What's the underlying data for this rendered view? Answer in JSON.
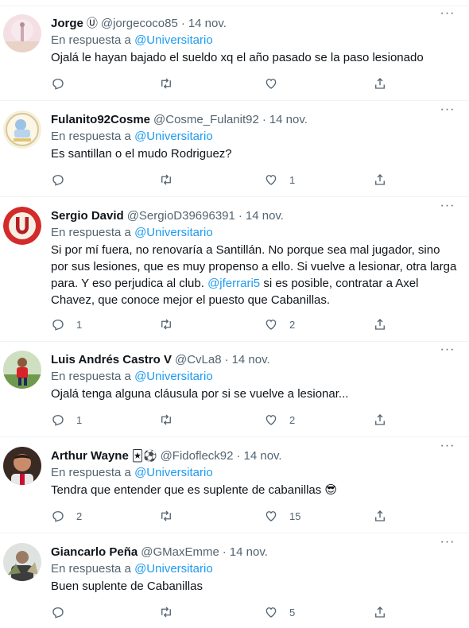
{
  "reply_prefix": "En respuesta a",
  "tweets": [
    {
      "name": "Jorge",
      "badge": "Ⓤ",
      "handle": "@jorgecoco85",
      "date": "14 nov.",
      "reply_to": "@Universitario",
      "text": "Ojalá le hayan bajado el sueldo xq el año pasado se la paso lesionado",
      "mention": "",
      "text_after": "",
      "counts": {
        "reply": "",
        "retweet": "",
        "like": ""
      }
    },
    {
      "name": "Fulanito92Cosme",
      "badge": "",
      "handle": "@Cosme_Fulanit92",
      "date": "14 nov.",
      "reply_to": "@Universitario",
      "text": "Es santillan o el mudo Rodriguez?",
      "mention": "",
      "text_after": "",
      "counts": {
        "reply": "",
        "retweet": "",
        "like": "1"
      }
    },
    {
      "name": "Sergio David",
      "badge": "",
      "handle": "@SergioD39696391",
      "date": "14 nov.",
      "reply_to": "@Universitario",
      "text": "Si por mí fuera, no renovaría a Santillán. No porque sea mal jugador, sino por sus lesiones, que es muy propenso a ello. Si vuelve a lesionar, otra larga para. Y eso perjudica al club. ",
      "mention": "@jferrari5",
      "text_after": " si es posible, contratar a Axel Chavez, que conoce mejor el puesto que Cabanillas.",
      "counts": {
        "reply": "1",
        "retweet": "",
        "like": "2"
      }
    },
    {
      "name": "Luis Andrés Castro V",
      "badge": "",
      "handle": "@CvLa8",
      "date": "14 nov.",
      "reply_to": "@Universitario",
      "text": "Ojalá tenga alguna cláusula por si se vuelve a lesionar...",
      "mention": "",
      "text_after": "",
      "counts": {
        "reply": "1",
        "retweet": "",
        "like": "2"
      }
    },
    {
      "name": "Arthur Wayne",
      "badge": "🃏⚽",
      "handle": "@Fidofleck92",
      "date": "14 nov.",
      "reply_to": "@Universitario",
      "text": "Tendra que entender que es suplente de cabanillas 😎",
      "mention": "",
      "text_after": "",
      "counts": {
        "reply": "2",
        "retweet": "",
        "like": "15"
      }
    },
    {
      "name": "Giancarlo Peña",
      "badge": "",
      "handle": "@GMaxEmme",
      "date": "14 nov.",
      "reply_to": "@Universitario",
      "text": "Buen suplente de Cabanillas",
      "mention": "",
      "text_after": "",
      "counts": {
        "reply": "",
        "retweet": "",
        "like": "5"
      }
    }
  ],
  "colors": {
    "link": "#1d9bf0",
    "muted": "#536471",
    "text": "#0f1419",
    "divider": "#eff3f4"
  }
}
